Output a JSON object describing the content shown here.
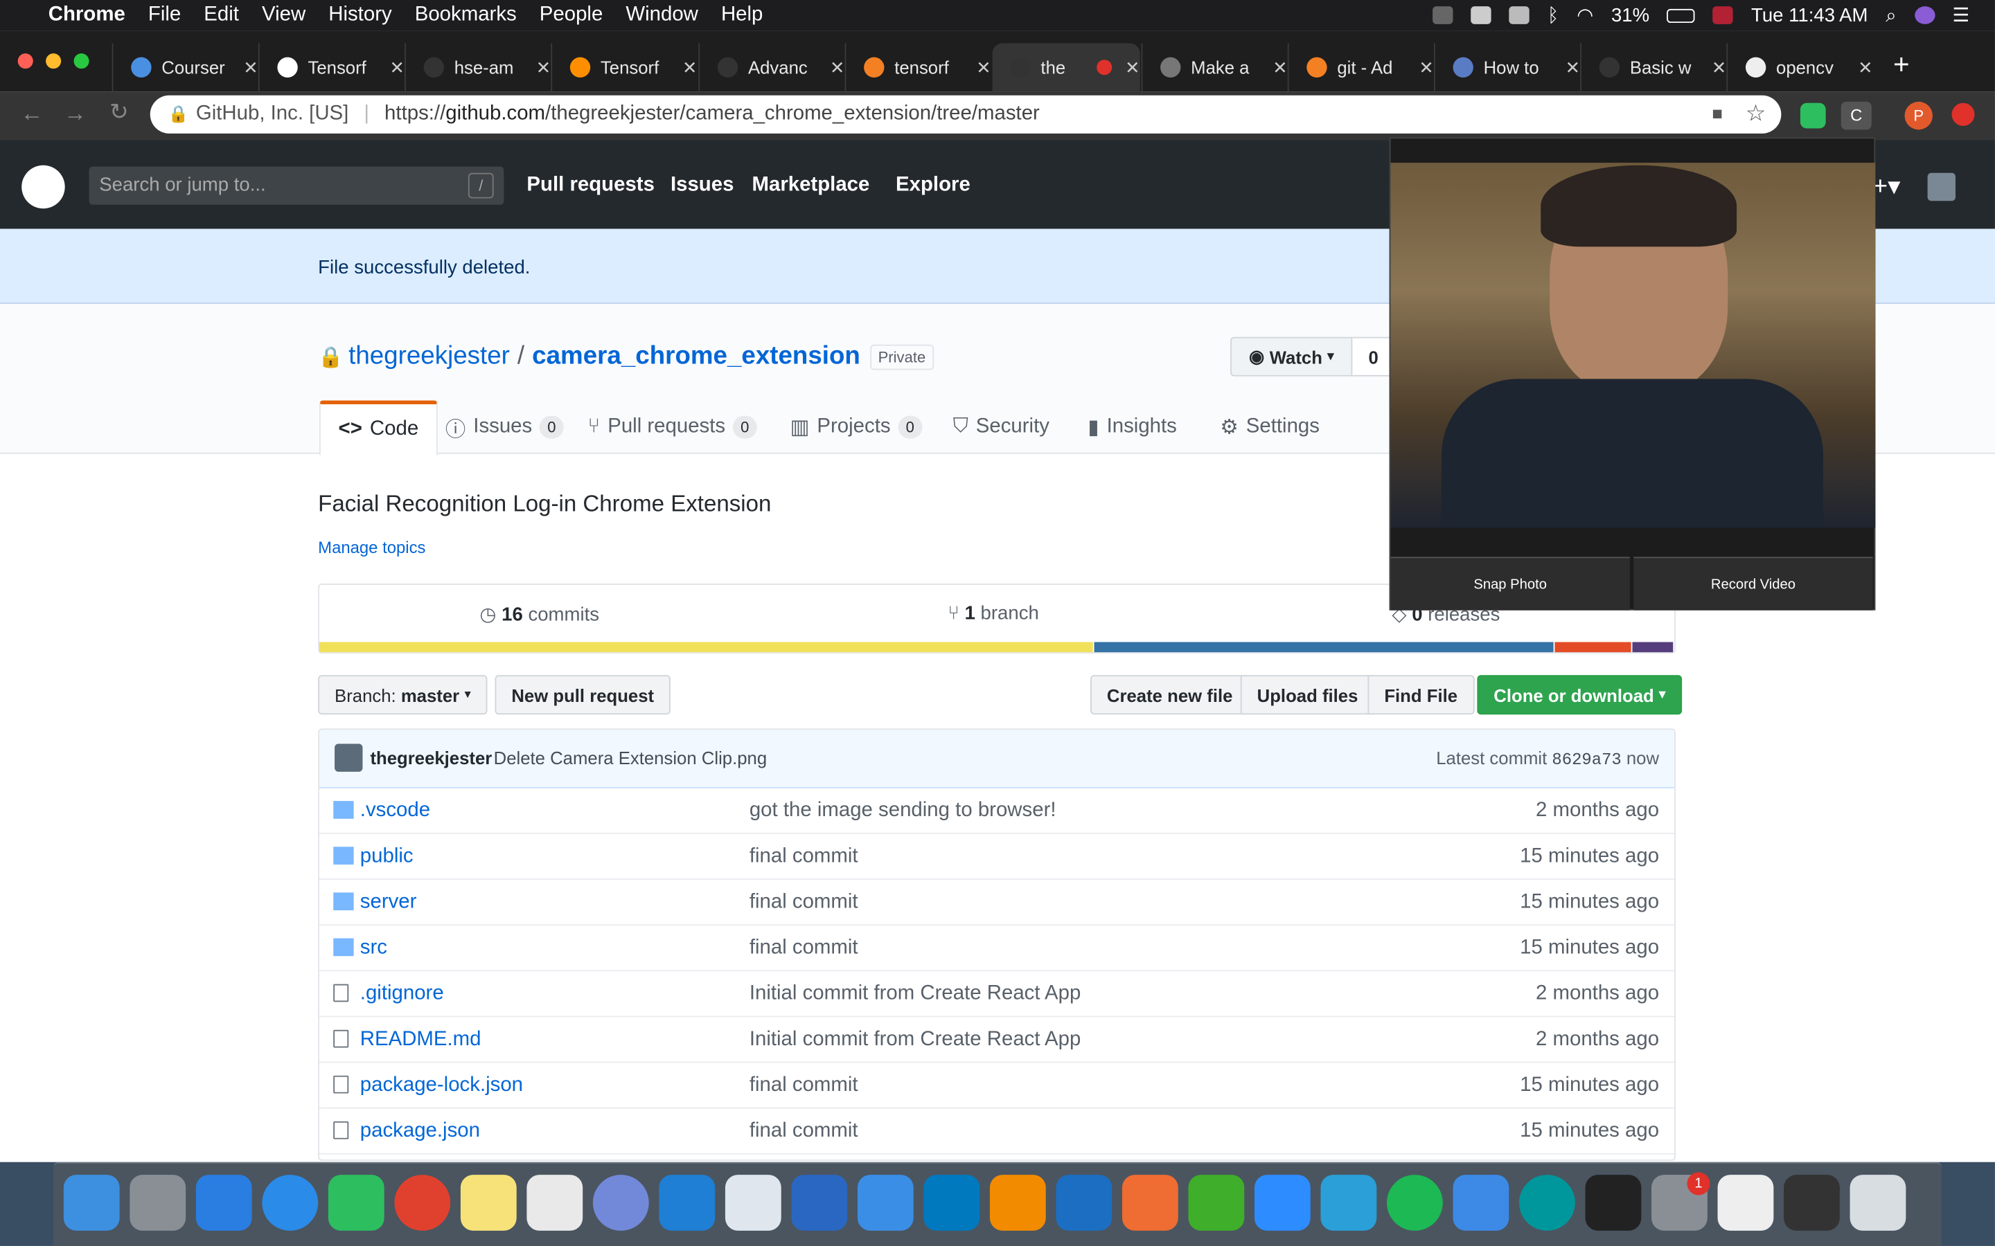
{
  "menubar": {
    "app": "Chrome",
    "items": [
      "File",
      "Edit",
      "View",
      "History",
      "Bookmarks",
      "People",
      "Window",
      "Help"
    ],
    "battery": "31%",
    "clock": "Tue 11:43 AM"
  },
  "tabs": [
    {
      "title": "Courser",
      "favicon": "infinity-icon",
      "color": "#4a90e2"
    },
    {
      "title": "Tensorf",
      "favicon": "tensor-icon",
      "color": "#ffffff"
    },
    {
      "title": "hse-am",
      "favicon": "github-icon",
      "color": "#333333"
    },
    {
      "title": "Tensorf",
      "favicon": "tensorflow-icon",
      "color": "#ff8f00"
    },
    {
      "title": "Advanc",
      "favicon": "github-icon",
      "color": "#333333"
    },
    {
      "title": "tensorf",
      "favicon": "stackoverflow-icon",
      "color": "#f48024"
    },
    {
      "title": "the",
      "favicon": "github-icon",
      "color": "#333333"
    },
    {
      "title": "Make a",
      "favicon": "doc-icon",
      "color": "#777777"
    },
    {
      "title": "git - Ad",
      "favicon": "stackoverflow-icon",
      "color": "#f48024"
    },
    {
      "title": "How to",
      "favicon": "wave-icon",
      "color": "#5a7cc4"
    },
    {
      "title": "Basic w",
      "favicon": "github-icon",
      "color": "#333333"
    },
    {
      "title": "opencv",
      "favicon": "hex-icon",
      "color": "#eeeeee"
    }
  ],
  "omnibox": {
    "secure_label": "GitHub, Inc. [US]",
    "url_prefix": "https://",
    "url_host": "github.com",
    "url_path": "/thegreekjester/camera_chrome_extension/tree/master"
  },
  "github": {
    "search_placeholder": "Search or jump to...",
    "search_hint": "/",
    "nav": [
      "Pull requests",
      "Issues",
      "Marketplace",
      "Explore"
    ]
  },
  "flash": "File successfully deleted.",
  "repo": {
    "owner": "thegreekjester",
    "separator": "/",
    "name": "camera_chrome_extension",
    "visibility": "Private",
    "watch_label": "Watch",
    "watch_count": "0",
    "tabs": [
      {
        "label": "Code",
        "count": ""
      },
      {
        "label": "Issues",
        "count": "0"
      },
      {
        "label": "Pull requests",
        "count": "0"
      },
      {
        "label": "Projects",
        "count": "0"
      },
      {
        "label": "Security",
        "count": ""
      },
      {
        "label": "Insights",
        "count": ""
      },
      {
        "label": "Settings",
        "count": ""
      }
    ],
    "description": "Facial Recognition Log-in Chrome Extension",
    "manage_topics": "Manage topics",
    "commits_count": "16",
    "commits_label": "commits",
    "branch_count": "1",
    "branch_label": "branch",
    "releases_count": "0",
    "releases_label": "releases",
    "languages": [
      {
        "color": "#f1e05a",
        "share": 0.573
      },
      {
        "color": "#3572a5",
        "share": 0.34
      },
      {
        "color": "#e34c26",
        "share": 0.057
      },
      {
        "color": "#563d7c",
        "share": 0.03
      }
    ]
  },
  "actions": {
    "branch_prefix": "Branch:",
    "branch_name": "master",
    "new_pr": "New pull request",
    "create_file": "Create new file",
    "upload": "Upload files",
    "find": "Find File",
    "clone": "Clone or download"
  },
  "commit": {
    "author": "thegreekjester",
    "message": "Delete Camera Extension Clip.png",
    "latest_label": "Latest commit",
    "sha": "8629a73",
    "time": "now"
  },
  "files": [
    {
      "type": "dir",
      "name": ".vscode",
      "message": "got the image sending to browser!",
      "age": "2 months ago"
    },
    {
      "type": "dir",
      "name": "public",
      "message": "final commit",
      "age": "15 minutes ago"
    },
    {
      "type": "dir",
      "name": "server",
      "message": "final commit",
      "age": "15 minutes ago"
    },
    {
      "type": "dir",
      "name": "src",
      "message": "final commit",
      "age": "15 minutes ago"
    },
    {
      "type": "file",
      "name": ".gitignore",
      "message": "Initial commit from Create React App",
      "age": "2 months ago"
    },
    {
      "type": "file",
      "name": "README.md",
      "message": "Initial commit from Create React App",
      "age": "2 months ago"
    },
    {
      "type": "file",
      "name": "package-lock.json",
      "message": "final commit",
      "age": "15 minutes ago"
    },
    {
      "type": "file",
      "name": "package.json",
      "message": "final commit",
      "age": "15 minutes ago"
    }
  ],
  "popup": {
    "snap": "Snap Photo",
    "record": "Record Video"
  },
  "dock": [
    {
      "name": "finder-icon",
      "color": "#3d8fe0"
    },
    {
      "name": "launchpad-icon",
      "color": "#8a8f96"
    },
    {
      "name": "testflight-icon",
      "color": "#2a7de1"
    },
    {
      "name": "safari-icon",
      "color": "#2b8be8"
    },
    {
      "name": "evernote-icon",
      "color": "#2dbe60"
    },
    {
      "name": "chrome-icon",
      "color": "#e0412f"
    },
    {
      "name": "notes-icon",
      "color": "#f7e27a"
    },
    {
      "name": "slack-icon",
      "color": "#e9e9e9"
    },
    {
      "name": "discord-icon",
      "color": "#7289da"
    },
    {
      "name": "vscode-icon",
      "color": "#1e7fd4"
    },
    {
      "name": "tableau-icon",
      "color": "#dfe6ee"
    },
    {
      "name": "r-icon",
      "color": "#2a67c2"
    },
    {
      "name": "arc-icon",
      "color": "#3a8ee6"
    },
    {
      "name": "trello-icon",
      "color": "#0079bf"
    },
    {
      "name": "vlc-icon",
      "color": "#f28b00"
    },
    {
      "name": "shark-icon",
      "color": "#1b6ec2"
    },
    {
      "name": "postman-icon",
      "color": "#ef6c33"
    },
    {
      "name": "circle-icon",
      "color": "#3fae2a"
    },
    {
      "name": "zoom-icon",
      "color": "#2d8cff"
    },
    {
      "name": "dots-icon",
      "color": "#2a9fd8"
    },
    {
      "name": "spotify-icon",
      "color": "#1db954"
    },
    {
      "name": "xcode-icon",
      "color": "#3c8ae6"
    },
    {
      "name": "arduino-icon",
      "color": "#00979c"
    },
    {
      "name": "terminal-icon",
      "color": "#222222"
    },
    {
      "name": "system-preferences-icon",
      "color": "#8a8f96"
    },
    {
      "name": "document-icon",
      "color": "#eeeeee"
    },
    {
      "name": "screenshot-icon",
      "color": "#333333"
    },
    {
      "name": "trash-icon",
      "color": "#d8dde2"
    }
  ],
  "dock_badge": "1"
}
